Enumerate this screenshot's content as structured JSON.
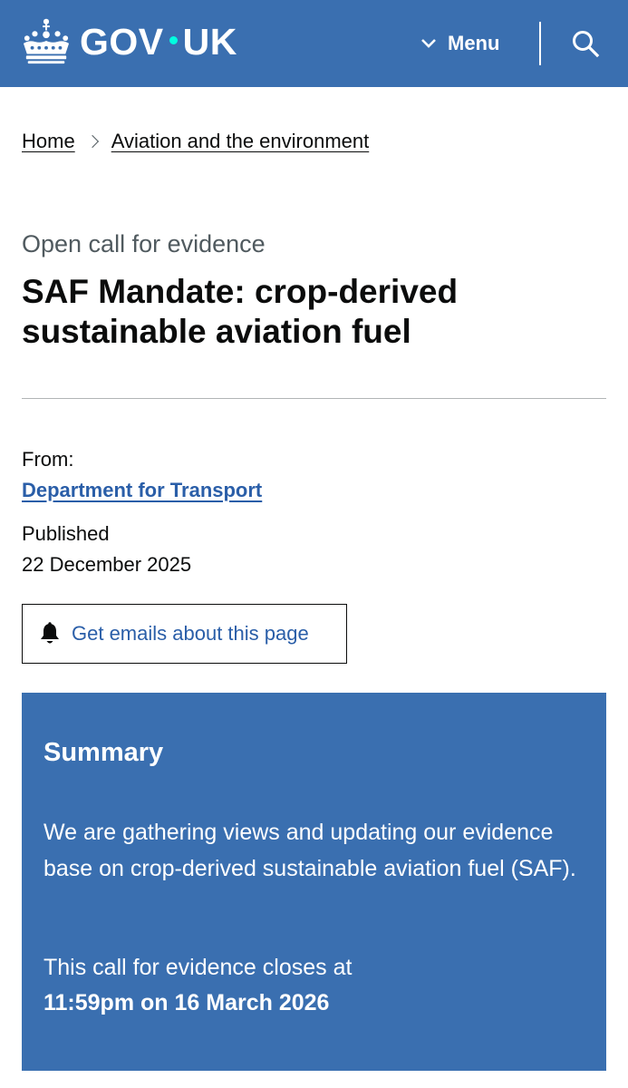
{
  "header": {
    "logo_text_left": "GOV",
    "logo_text_right": "UK",
    "menu_label": "Menu",
    "search_icon": "search-icon",
    "colors": {
      "bg": "#3a6fb0",
      "dot": "#00ffe0"
    }
  },
  "breadcrumb": {
    "items": [
      "Home",
      "Aviation and the environment"
    ]
  },
  "page": {
    "caption": "Open call for evidence",
    "title": "SAF Mandate: crop-derived sustainable aviation fuel"
  },
  "meta": {
    "from_label": "From:",
    "organisation": "Department for Transport",
    "published_label": "Published",
    "published_date": "22 December 2025"
  },
  "emails_button": {
    "label": "Get emails about this page",
    "icon": "bell-icon"
  },
  "summary": {
    "title": "Summary",
    "body": "We are gathering views and updating our evidence base on crop-derived sustainable aviation fuel (SAF).",
    "closes_text": "This call for evidence closes at",
    "closes_date": "11:59pm on 16 March 2026"
  }
}
